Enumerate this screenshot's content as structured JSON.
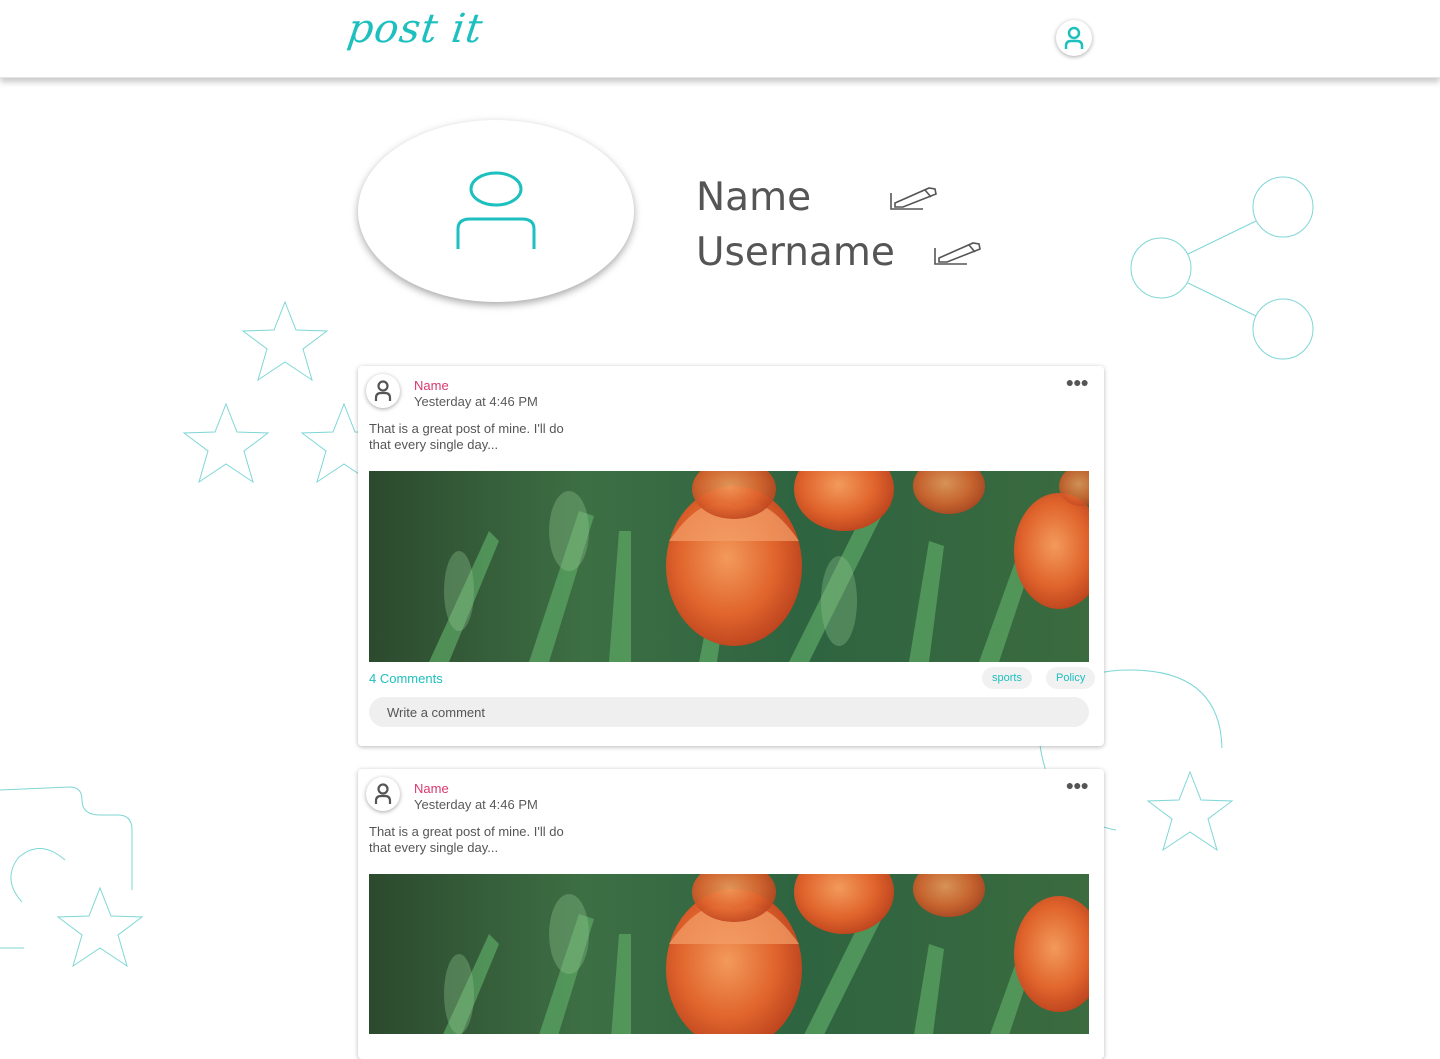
{
  "header": {
    "logo": "post it",
    "avatar_icon": "user-icon"
  },
  "profile": {
    "avatar_icon": "user-icon",
    "name": "Name",
    "username": "Username",
    "edit_icon": "pencil-icon"
  },
  "colors": {
    "accent": "#1ebfbf",
    "author": "#d9376e",
    "text": "#5a5a5a",
    "input_bg": "#efefef"
  },
  "posts": [
    {
      "author": "Name",
      "time": "Yesterday at 4:46 PM",
      "text": "That is a great post of mine. I'll do that every single day...",
      "image": "tulips-photo",
      "comments": "4 Comments",
      "tags": [
        "sports",
        "Policy"
      ],
      "comment_placeholder": "Write a comment",
      "menu_icon": "more-dots-icon"
    },
    {
      "author": "Name",
      "time": "Yesterday at 4:46 PM",
      "text": "That is a great post of mine. I'll do that every single day...",
      "image": "tulips-photo"
    }
  ]
}
